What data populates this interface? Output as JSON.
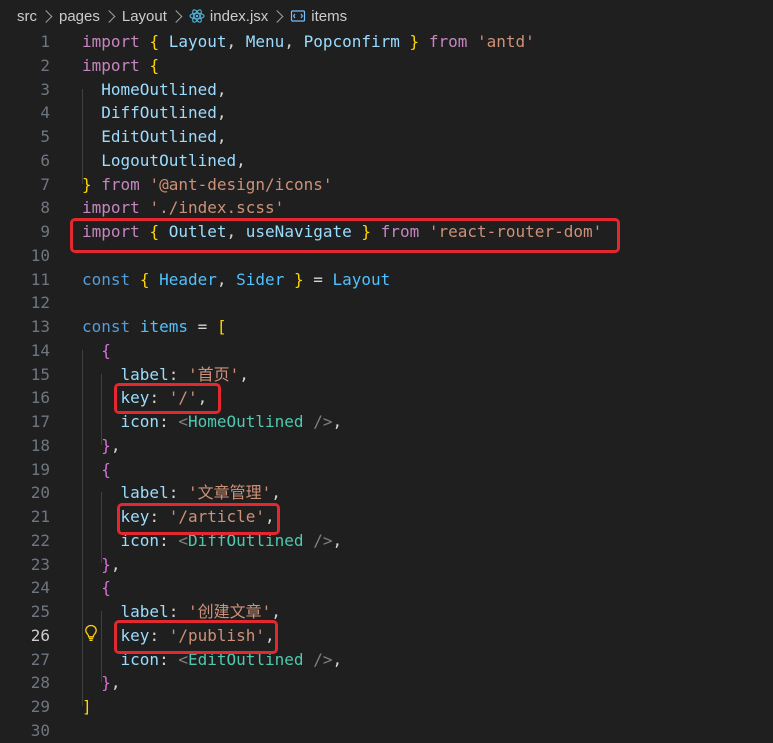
{
  "breadcrumb": {
    "items": [
      "src",
      "pages",
      "Layout",
      "index.jsx",
      "items"
    ],
    "file_icon": "react-file-icon",
    "symbol_icon": "symbol-variable-icon"
  },
  "colors": {
    "background": "#1f1f1f",
    "keyword_import": "#c586c0",
    "string": "#ce9178",
    "variable": "#9cdcfe",
    "constant": "#4fc1ff",
    "storage": "#569cd6",
    "component": "#4ec9b0",
    "highlight_box": "#e3282f"
  },
  "editor": {
    "active_line": 26,
    "lines": [
      {
        "n": "1",
        "t": "import { Layout, Menu, Popconfirm } from 'antd'"
      },
      {
        "n": "2",
        "t": "import {"
      },
      {
        "n": "3",
        "t": "  HomeOutlined,"
      },
      {
        "n": "4",
        "t": "  DiffOutlined,"
      },
      {
        "n": "5",
        "t": "  EditOutlined,"
      },
      {
        "n": "6",
        "t": "  LogoutOutlined,"
      },
      {
        "n": "7",
        "t": "} from '@ant-design/icons'"
      },
      {
        "n": "8",
        "t": "import './index.scss'"
      },
      {
        "n": "9",
        "t": "import { Outlet, useNavigate } from 'react-router-dom'"
      },
      {
        "n": "10",
        "t": ""
      },
      {
        "n": "11",
        "t": "const { Header, Sider } = Layout"
      },
      {
        "n": "12",
        "t": ""
      },
      {
        "n": "13",
        "t": "const items = ["
      },
      {
        "n": "14",
        "t": "  {"
      },
      {
        "n": "15",
        "t": "    label: '首页',"
      },
      {
        "n": "16",
        "t": "    key: '/',"
      },
      {
        "n": "17",
        "t": "    icon: <HomeOutlined />,"
      },
      {
        "n": "18",
        "t": "  },"
      },
      {
        "n": "19",
        "t": "  {"
      },
      {
        "n": "20",
        "t": "    label: '文章管理',"
      },
      {
        "n": "21",
        "t": "    key: '/article',"
      },
      {
        "n": "22",
        "t": "    icon: <DiffOutlined />,"
      },
      {
        "n": "23",
        "t": "  },"
      },
      {
        "n": "24",
        "t": "  {"
      },
      {
        "n": "25",
        "t": "    label: '创建文章',"
      },
      {
        "n": "26",
        "t": "    key: '/publish',"
      },
      {
        "n": "27",
        "t": "    icon: <EditOutlined />,"
      },
      {
        "n": "28",
        "t": "  },"
      },
      {
        "n": "29",
        "t": "]"
      },
      {
        "n": "30",
        "t": ""
      }
    ]
  }
}
